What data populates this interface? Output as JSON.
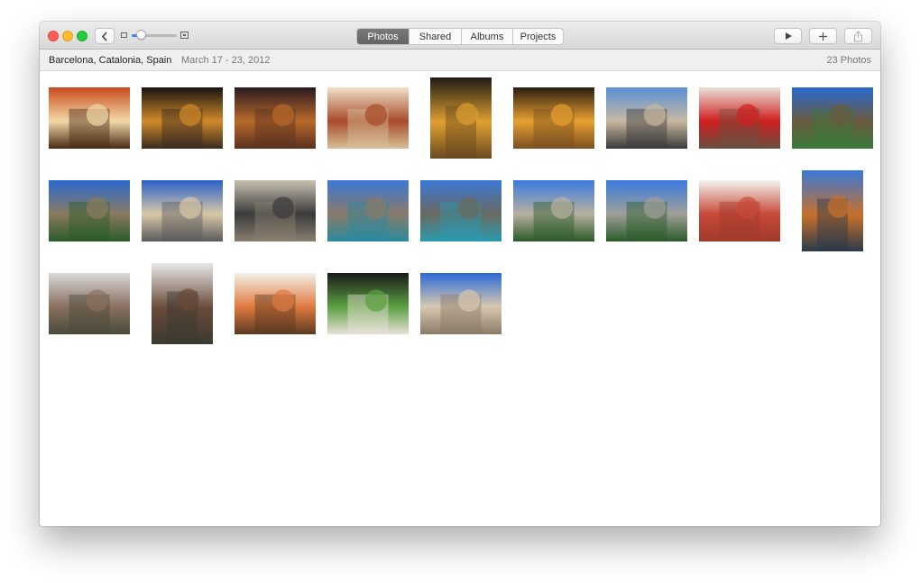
{
  "toolbar": {
    "segments": [
      "Photos",
      "Shared",
      "Albums",
      "Projects"
    ],
    "active_segment": "Photos",
    "zoom_level": 0.2
  },
  "infobar": {
    "location": "Barcelona, Catalonia, Spain",
    "date_range": "March 17 - 23, 2012",
    "count": "23 Photos"
  },
  "icons": [
    "chevron-left-icon",
    "zoom-small-icon",
    "zoom-large-icon",
    "play-icon",
    "plus-icon",
    "share-icon"
  ],
  "photos": [
    {
      "subject": "paella",
      "orientation": "landscape",
      "palette": [
        "#c84a1c",
        "#f2d9a8",
        "#4a2a14"
      ]
    },
    {
      "subject": "night-street",
      "orientation": "landscape",
      "palette": [
        "#1a140f",
        "#d08a2a",
        "#3a2a20"
      ]
    },
    {
      "subject": "night-building",
      "orientation": "landscape",
      "palette": [
        "#2a1a20",
        "#b86a2a",
        "#5a3020"
      ]
    },
    {
      "subject": "plate-of-food",
      "orientation": "landscape",
      "palette": [
        "#f0e0c8",
        "#a84a2a",
        "#d8c098"
      ]
    },
    {
      "subject": "night-facade",
      "orientation": "portrait",
      "palette": [
        "#1e1a14",
        "#e0a030",
        "#6a4a20"
      ]
    },
    {
      "subject": "night-square",
      "orientation": "landscape",
      "palette": [
        "#2a1e10",
        "#e8a030",
        "#7a5020"
      ]
    },
    {
      "subject": "city-view",
      "orientation": "landscape",
      "palette": [
        "#5a90d8",
        "#c8b8a0",
        "#3a3a3a"
      ]
    },
    {
      "subject": "big-mac-box",
      "orientation": "landscape",
      "palette": [
        "#e8e0d8",
        "#d02020",
        "#6a5040"
      ]
    },
    {
      "subject": "arc-de-triomf",
      "orientation": "landscape",
      "palette": [
        "#2a6ad0",
        "#6a5a40",
        "#3a7a3a"
      ]
    },
    {
      "subject": "arc-promenade",
      "orientation": "landscape",
      "palette": [
        "#2a6ad0",
        "#8a7a60",
        "#2a5a2a"
      ]
    },
    {
      "subject": "palace-facade",
      "orientation": "landscape",
      "palette": [
        "#2a60c8",
        "#d8c8a8",
        "#5a5a5a"
      ]
    },
    {
      "subject": "shop-front",
      "orientation": "landscape",
      "palette": [
        "#c8c0b0",
        "#3a3a3a",
        "#8a8070"
      ]
    },
    {
      "subject": "market-hall",
      "orientation": "landscape",
      "palette": [
        "#3a78d8",
        "#8a7a68",
        "#2a8aa0"
      ]
    },
    {
      "subject": "market-hall-2",
      "orientation": "landscape",
      "palette": [
        "#3a78d8",
        "#6a6a60",
        "#2a9ab0"
      ]
    },
    {
      "subject": "palm-promenade",
      "orientation": "landscape",
      "palette": [
        "#3a7ae0",
        "#b8b0a0",
        "#2a5a2a"
      ]
    },
    {
      "subject": "palm-promenade-2",
      "orientation": "landscape",
      "palette": [
        "#3a7ae0",
        "#a0a098",
        "#2a5a2a"
      ]
    },
    {
      "subject": "red-arch",
      "orientation": "landscape",
      "palette": [
        "#f4f4f0",
        "#c84a3a",
        "#a03a2a"
      ]
    },
    {
      "subject": "tower",
      "orientation": "portrait",
      "palette": [
        "#3a78d8",
        "#c8702a",
        "#2a3a4a"
      ]
    },
    {
      "subject": "church-trees",
      "orientation": "landscape",
      "palette": [
        "#d8d8d8",
        "#8a7060",
        "#4a4a3a"
      ]
    },
    {
      "subject": "modernist-house",
      "orientation": "portrait",
      "palette": [
        "#e8e8e8",
        "#6a4a3a",
        "#3a3a30"
      ]
    },
    {
      "subject": "soup-bowl",
      "orientation": "landscape",
      "palette": [
        "#f4f0e8",
        "#e07a40",
        "#5a3a20"
      ]
    },
    {
      "subject": "salad",
      "orientation": "landscape",
      "palette": [
        "#1a1a1a",
        "#5aa040",
        "#e8e0d8"
      ]
    },
    {
      "subject": "casa-mila",
      "orientation": "landscape",
      "palette": [
        "#2a6ad8",
        "#d8c8b0",
        "#8a7a68"
      ]
    }
  ]
}
